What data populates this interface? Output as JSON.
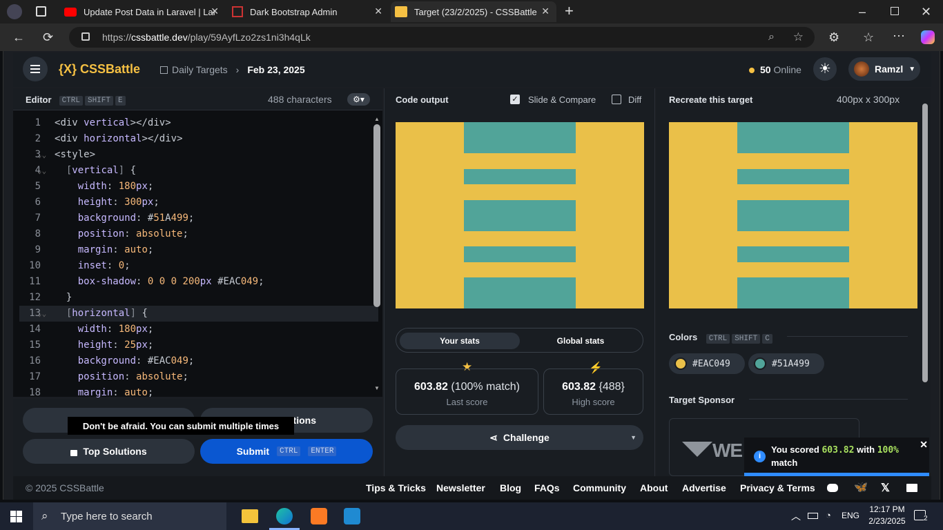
{
  "browser": {
    "tabs": [
      {
        "title": "Update Post Data in Laravel | Lara",
        "icon": "youtube-icon"
      },
      {
        "title": "Dark Bootstrap Admin",
        "icon": "laravel-icon"
      },
      {
        "title": "Target (23/2/2025) - CSSBattle",
        "icon": "cssbattle-icon"
      }
    ],
    "url_prefix": "https://",
    "url_domain": "cssbattle.dev",
    "url_path": "/play/59AyfLzo2zs1ni3h4qLk"
  },
  "header": {
    "logo": "{X} CSSBattle",
    "crumb_daily": "Daily Targets",
    "crumb_date": "Feb 23, 2025",
    "online_count": "50",
    "online_label": "Online",
    "username": "Ramzl"
  },
  "editor": {
    "title": "Editor",
    "shortcut": [
      "CTRL",
      "SHIFT",
      "E"
    ],
    "characters": "488 characters",
    "lines": [
      {
        "n": "1",
        "text": "<div vertical></div>"
      },
      {
        "n": "2",
        "text": "<div horizontal></div>"
      },
      {
        "n": "3",
        "text": "<style>"
      },
      {
        "n": "4",
        "text": "  [vertical] {"
      },
      {
        "n": "5",
        "text": "    width: 180px;"
      },
      {
        "n": "6",
        "text": "    height: 300px;"
      },
      {
        "n": "7",
        "text": "    background: #51A499;"
      },
      {
        "n": "8",
        "text": "    position: absolute;"
      },
      {
        "n": "9",
        "text": "    margin: auto;"
      },
      {
        "n": "10",
        "text": "    inset: 0;"
      },
      {
        "n": "11",
        "text": "    box-shadow: 0 0 0 200px #EAC049;"
      },
      {
        "n": "12",
        "text": "  }"
      },
      {
        "n": "13",
        "text": "  [horizontal] {"
      },
      {
        "n": "14",
        "text": "    width: 180px;"
      },
      {
        "n": "15",
        "text": "    height: 25px;"
      },
      {
        "n": "16",
        "text": "    background: #EAC049;"
      },
      {
        "n": "17",
        "text": "    position: absolute;"
      },
      {
        "n": "18",
        "text": "    margin: auto;"
      }
    ]
  },
  "actions": {
    "tooltip": "Don't be afraid. You can submit multiple times",
    "solutions_fragment": "tions",
    "top_solutions": "Top Solutions",
    "submit": "Submit",
    "submit_keys": [
      "CTRL",
      "ENTER"
    ]
  },
  "output": {
    "title": "Code output",
    "slide_compare": "Slide & Compare",
    "diff": "Diff",
    "stats_tab_your": "Your stats",
    "stats_tab_global": "Global stats",
    "last_score_value": "603.82",
    "last_score_extra": "(100% match)",
    "last_score_label": "Last score",
    "high_score_value": "603.82",
    "high_score_extra": "{488}",
    "high_score_label": "High score",
    "challenge": "Challenge"
  },
  "target": {
    "title": "Recreate this target",
    "size": "400px x 300px",
    "colors_title": "Colors",
    "colors_keys": [
      "CTRL",
      "SHIFT",
      "C"
    ],
    "colors": [
      {
        "hex": "#EAC049",
        "label": "#EAC049"
      },
      {
        "hex": "#51A499",
        "label": "#51A499"
      }
    ],
    "sponsor_title": "Target Sponsor",
    "sponsor_logo_text": "WE"
  },
  "toast": {
    "prefix": "You scored",
    "score": "603.82",
    "mid": "with",
    "pct": "100%",
    "suffix": "match"
  },
  "footer": {
    "copyright": "© 2025 CSSBattle",
    "links": [
      "Tips & Tricks",
      "Newsletter",
      "Blog",
      "FAQs",
      "Community",
      "About",
      "Advertise",
      "Privacy & Terms"
    ]
  },
  "taskbar": {
    "search_placeholder": "Type here to search",
    "lang": "ENG",
    "time": "12:17 PM",
    "date": "2/23/2025",
    "notif_count": "2"
  },
  "theme": {
    "yellow": "#EAC049",
    "teal": "#51A499",
    "accent_blue": "#0a57d1"
  }
}
